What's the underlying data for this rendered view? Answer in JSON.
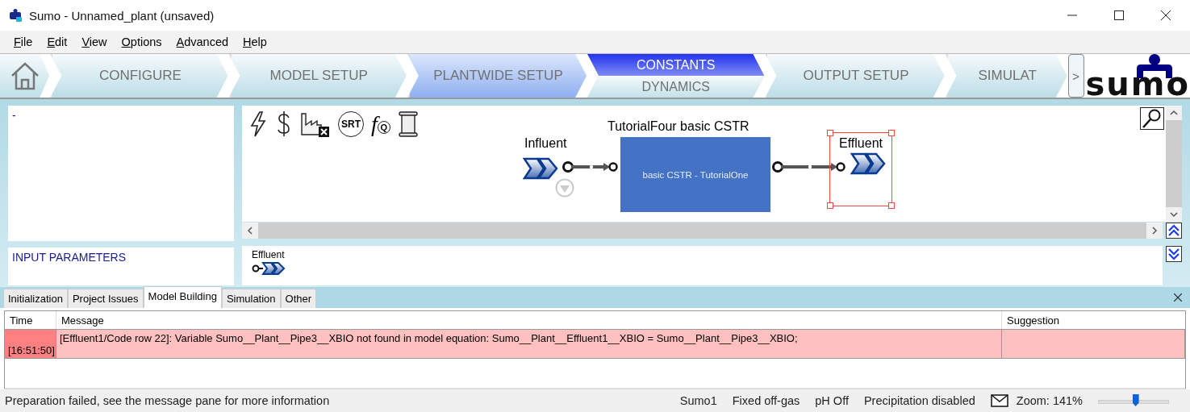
{
  "window": {
    "title": "Sumo - Unnamed_plant (unsaved)"
  },
  "menu": [
    {
      "label": "File"
    },
    {
      "label": "Edit"
    },
    {
      "label": "View"
    },
    {
      "label": "Options"
    },
    {
      "label": "Advanced"
    },
    {
      "label": "Help"
    }
  ],
  "workflow": {
    "steps": [
      {
        "kind": "single",
        "label": "CONFIGURE",
        "highlighted": false
      },
      {
        "kind": "single",
        "label": "MODEL SETUP",
        "highlighted": false
      },
      {
        "kind": "single",
        "label": "PLANTWIDE SETUP",
        "highlighted": true
      },
      {
        "kind": "split",
        "parts": [
          {
            "label": "CONSTANTS",
            "selected": true
          },
          {
            "label": "DYNAMICS",
            "selected": false
          }
        ]
      },
      {
        "kind": "single",
        "label": "OUTPUT SETUP",
        "highlighted": false
      },
      {
        "kind": "single",
        "label": "SIMULAT",
        "highlighted": false
      }
    ],
    "scroll_label": ">",
    "logo": "sumo"
  },
  "left_panel": {
    "text": "-"
  },
  "toolbar": [
    {
      "kind": "power"
    },
    {
      "kind": "cost"
    },
    {
      "kind": "factory"
    },
    {
      "kind": "srt",
      "label": "SRT"
    },
    {
      "kind": "function",
      "label": "f",
      "sub": "Q"
    },
    {
      "kind": "scroll"
    }
  ],
  "diagram": {
    "influent": {
      "label": "Influent"
    },
    "unit": {
      "title": "TutorialFour basic CSTR",
      "label": "basic CSTR - TutorialOne"
    },
    "effluent": {
      "label": "Effluent",
      "selected": true
    }
  },
  "parameters_panel": {
    "title": "INPUT PARAMETERS"
  },
  "palette": [
    {
      "label": "Effluent"
    }
  ],
  "message_tabs": [
    {
      "label": "Initialization",
      "selected": false
    },
    {
      "label": "Project Issues",
      "selected": false
    },
    {
      "label": "Model Building",
      "selected": true
    },
    {
      "label": "Simulation",
      "selected": false
    },
    {
      "label": "Other",
      "selected": false
    }
  ],
  "table": {
    "columns": [
      "Time",
      "Message",
      "Suggestion"
    ],
    "rows": [
      {
        "kind": "error",
        "time": "[16:51:50]",
        "message": "[Effluent1/Code row 22]: Variable Sumo__Plant__Pipe3__XBIO not found in model equation: Sumo__Plant__Effluent1__XBIO = Sumo__Plant__Pipe3__XBIO;"
      }
    ]
  },
  "status_bar": {
    "message": "Preparation failed, see the message pane for more information",
    "items": [
      "Sumo1",
      "Fixed off-gas",
      "pH Off",
      "Precipitation disabled"
    ],
    "zoom": "Zoom: 141%",
    "level": 0.53
  }
}
